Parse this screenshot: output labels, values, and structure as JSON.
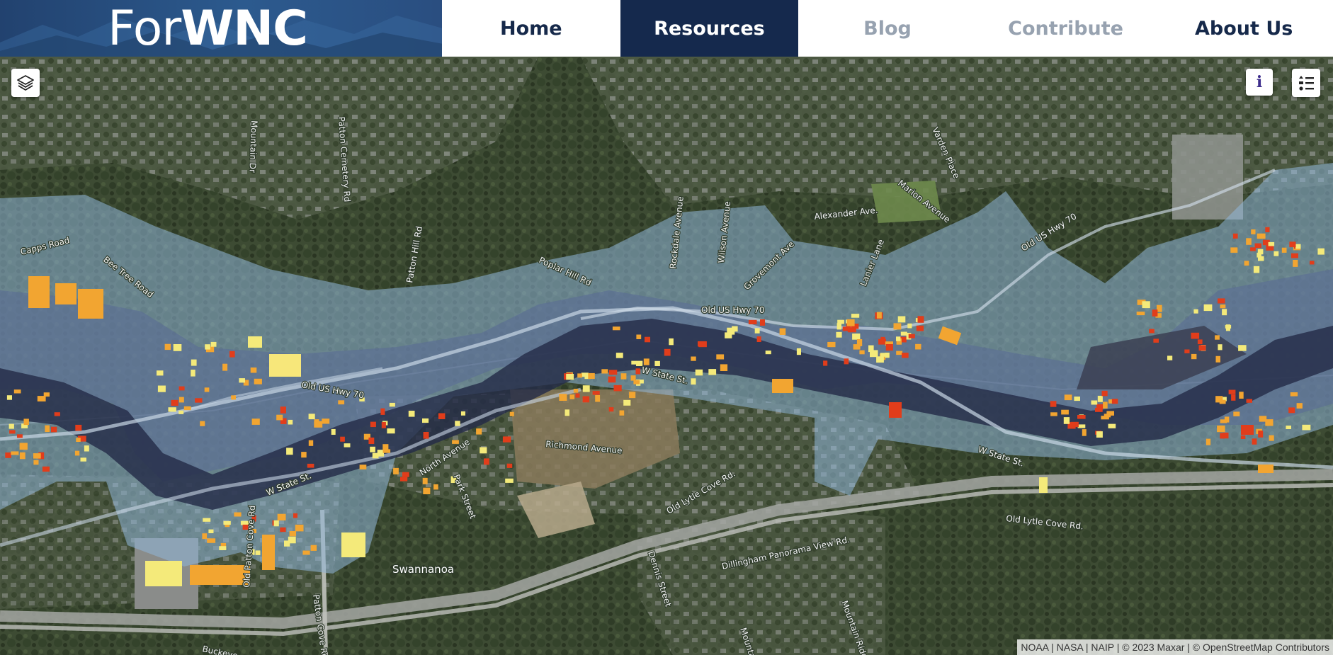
{
  "header": {
    "logo_light": "For",
    "logo_bold": "WNC",
    "nav": [
      {
        "label": "Home",
        "active": false
      },
      {
        "label": "Resources",
        "active": true
      },
      {
        "label": "Blog",
        "active": false,
        "muted": true
      },
      {
        "label": "Contribute",
        "active": false,
        "muted": true
      },
      {
        "label": "About Us",
        "active": false
      }
    ]
  },
  "map": {
    "basemap": "satellite imagery",
    "overlays": [
      "flood depth area (blue shades)",
      "impacted buildings (yellow-orange-red)"
    ],
    "labels": {
      "capps_road": "Capps Road",
      "beetree_road": "Bee Tree Road",
      "patton_cemetery": "Patton Cemetery Rd",
      "mountain_dr": "Mountain Dr",
      "patton_hill": "Patton Hill Rd",
      "poplar_hill": "Poplar Hill Rd",
      "rockdale": "Rockdale Avenue",
      "wilson": "Wilson Avenue",
      "grovemont": "Grovemont Ave",
      "alexander": "Alexander Ave.",
      "marion": "Marion Avenue",
      "varden": "Varden Place",
      "crestview": "Lanier Lane",
      "old_us_70_east": "Old US Hwy 70",
      "old_us_70_mid": "Old US Hwy 70",
      "old_us_70_west": "Old US Hwy 70",
      "w_state_east": "W State St.",
      "w_state_mid": "W State St.",
      "w_state_west": "W State St.",
      "richmond": "Richmond Avenue",
      "north_ave": "North Avenue",
      "park_st": "Park Street",
      "old_lytle_cove": "Old Lytle Cove Rd.",
      "old_lytle_cove_2": "Old Lytle Cove Rd.",
      "dennis": "Dennis Street",
      "dillingham": "Dillingham Panorama View Rd.",
      "old_patton_cove": "Old Patton Cove Rd",
      "patton_cove": "Patton Cove Rd",
      "mountain_way": "Mountain Way",
      "mountain_ridge": "Mountain Ridge Dr",
      "buckeye": "Buckeye",
      "swannanoa": "Swannanoa"
    },
    "attribution": "NOAA | NASA | NAIP | © 2023 Maxar | © OpenStreetMap Contributors"
  },
  "controls": {
    "info_label": "i",
    "layers_icon": "layers-icon",
    "legend_icon": "legend-list-icon"
  },
  "colors": {
    "nav_dark": "#15294d",
    "flood_light": "#8fb6d8",
    "flood_deep": "#2b3558",
    "building_low": "#f4ea7a",
    "building_mid": "#f2a531",
    "building_high": "#e13d1b"
  }
}
